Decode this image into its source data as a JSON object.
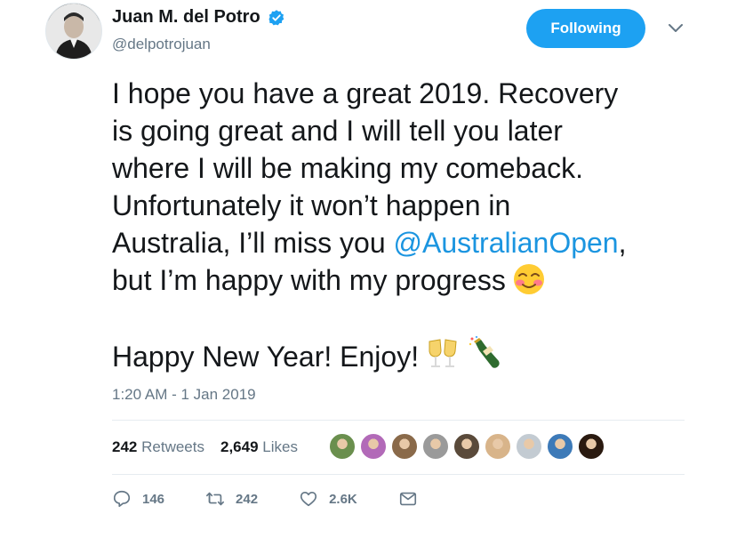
{
  "author": {
    "name": "Juan M. del Potro",
    "handle": "@delpotrojuan",
    "verified": true
  },
  "follow_button": {
    "label": "Following",
    "color": "#1da1f2"
  },
  "tweet": {
    "line1": "I hope you have a great 2019. Recovery",
    "line2": "is going great and I will tell you later",
    "line3": "where I will be making my comeback.",
    "line4": "Unfortunately it won’t happen in",
    "line5_pre": "Australia, I’ll miss you ",
    "mention": "@AustralianOpen",
    "line5_post": ",",
    "line6": "but I’m happy with my progress",
    "line7": "Happy New Year! Enjoy!",
    "emojis": [
      "smiling-blushing-emoji",
      "clinking-glasses-emoji",
      "champagne-bottle-emoji"
    ]
  },
  "timestamp": "1:20 AM - 1 Jan 2019",
  "stats": {
    "retweets_count": "242",
    "retweets_label": "Retweets",
    "likes_count": "2,649",
    "likes_label": "Likes"
  },
  "likers": [
    {
      "color": "#6a8f4e"
    },
    {
      "color": "#b26ab8"
    },
    {
      "color": "#8a6a4a"
    },
    {
      "color": "#9a9a9a"
    },
    {
      "color": "#5a4a3a"
    },
    {
      "color": "#d8b48a"
    },
    {
      "color": "#c3cbd2"
    },
    {
      "color": "#3d7ab8"
    },
    {
      "color": "#2a1a10"
    }
  ],
  "actions": {
    "replies": "146",
    "retweets": "242",
    "likes": "2.6K"
  },
  "accent_color": "#1b95e0"
}
